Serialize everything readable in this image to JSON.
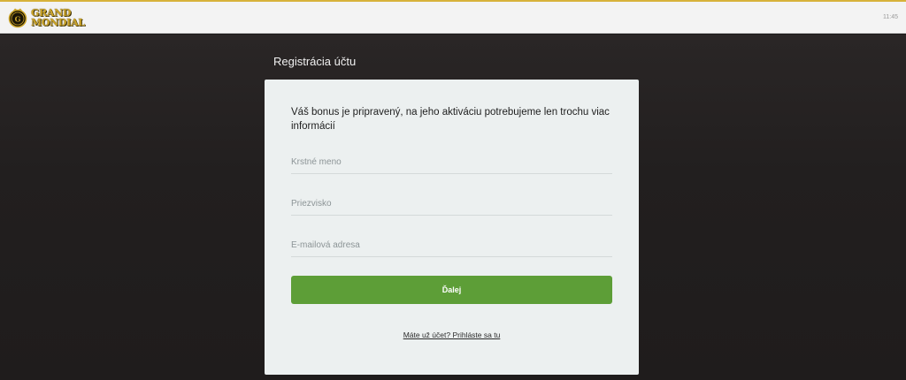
{
  "header": {
    "logo_line1": "GRAND",
    "logo_line2": "MONDIAL",
    "logo_emblem_icon": "crowned-gm-emblem-icon",
    "clock": "11:45",
    "accent_color": "#d7b23a"
  },
  "page": {
    "title": "Registrácia účtu"
  },
  "form": {
    "intro": "Váš bonus je pripravený, na jeho aktiváciu potrebujeme len trochu viac informácií",
    "first_name_placeholder": "Krstné meno",
    "last_name_placeholder": "Priezvisko",
    "email_placeholder": "E-mailová adresa",
    "next_label": "Ďalej",
    "next_color": "#5d9e37",
    "login_link": "Máte už účet? Prihláste sa tu"
  }
}
